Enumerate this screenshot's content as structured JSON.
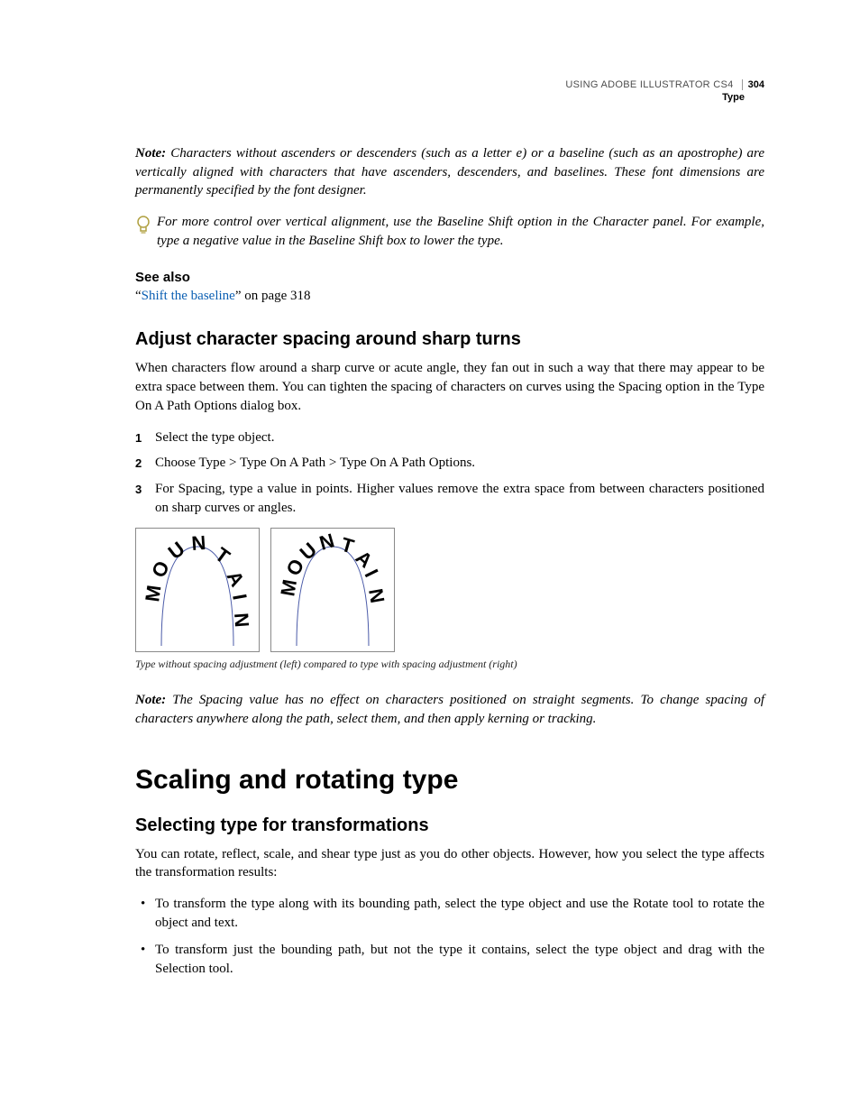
{
  "header": {
    "book": "USING ADOBE ILLUSTRATOR CS4",
    "pagenum": "304",
    "section": "Type"
  },
  "note1": {
    "label": "Note:",
    "text": " Characters without ascenders or descenders (such as a letter e) or a baseline (such as an apostrophe) are vertically aligned with characters that have ascenders, descenders, and baselines. These font dimensions are permanently specified by the font designer."
  },
  "tip": {
    "text": "For more control over vertical alignment, use the Baseline Shift option in the Character panel. For example, type a negative value in the Baseline Shift box to lower the type."
  },
  "see_also": {
    "heading": "See also",
    "quote_open": "“",
    "link": "Shift the baseline",
    "quote_close": "” on page 318"
  },
  "sec1": {
    "title": "Adjust character spacing around sharp turns",
    "intro": "When characters flow around a sharp curve or acute angle, they fan out in such a way that there may appear to be extra space between them. You can tighten the spacing of characters on curves using the Spacing option in the Type On A Path Options dialog box.",
    "steps": [
      "Select the type object.",
      "Choose Type > Type On A Path > Type On A Path Options.",
      "For Spacing, type a value in points. Higher values remove the extra space from between characters positioned on sharp curves or angles."
    ],
    "fig_letters": [
      "M",
      "O",
      "U",
      "N",
      "T",
      "A",
      "I",
      "N"
    ],
    "fig_caption": "Type without spacing adjustment (left) compared to type with spacing adjustment (right)"
  },
  "note2": {
    "label": "Note:",
    "text": " The Spacing value has no effect on characters positioned on straight segments. To change spacing of characters anywhere along the path, select them, and then apply kerning or tracking."
  },
  "major": {
    "title": "Scaling and rotating type"
  },
  "sec2": {
    "title": "Selecting type for transformations",
    "intro": "You can rotate, reflect, scale, and shear type just as you do other objects. However, how you select the type affects the transformation results:",
    "bullets": [
      "To transform the type along with its bounding path, select the type object and use the Rotate tool to rotate the object and text.",
      "To transform just the bounding path, but not the type it contains, select the type object and drag with the Selection tool."
    ]
  }
}
